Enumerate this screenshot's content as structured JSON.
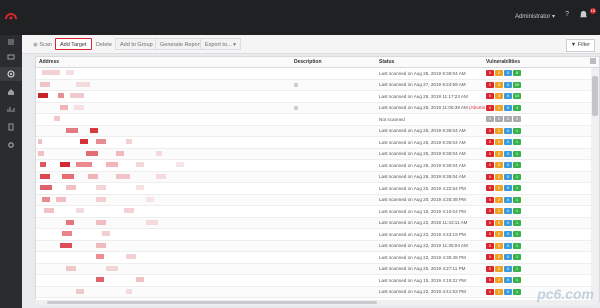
{
  "header": {
    "user_menu": "Administrator ▾",
    "help": "?",
    "notification_count": "18"
  },
  "toolbar": {
    "scan": "Scan",
    "add_target": "Add Target",
    "delete": "Delete",
    "add_to_group": "Add to Group",
    "generate_report": "Generate Report",
    "export": "Export to... ▾",
    "filter": "Filter"
  },
  "table": {
    "columns": [
      "Address",
      "Description",
      "Status",
      "Vulnerabilities"
    ],
    "rows": [
      {
        "status": "Last scanned on Aug 26, 2019 9:36:04 AM",
        "warn": "",
        "vulns": [
          "0",
          "2",
          "0",
          "8"
        ]
      },
      {
        "status": "Last scanned on Aug 27, 2019 9:24:59 AM",
        "warn": "",
        "vulns": [
          "0",
          "3",
          "0",
          "20"
        ]
      },
      {
        "status": "Last scanned on Aug 26, 2019 11:17:23 AM",
        "warn": "",
        "vulns": [
          "0",
          "3",
          "0",
          "10"
        ]
      },
      {
        "status": "Last scanned on Aug 26, 2019 11:06:39 AM",
        "warn": "(Abortin",
        "vulns": [
          "0",
          "1",
          "0",
          "4"
        ]
      },
      {
        "status": "Not scanned",
        "warn": "",
        "vulns": [
          "0",
          "0",
          "0",
          "0"
        ]
      },
      {
        "status": "Last scanned on Aug 26, 2019 9:36:04 AM",
        "warn": "",
        "vulns": [
          "0",
          "2",
          "0",
          "1"
        ]
      },
      {
        "status": "Last scanned on Aug 26, 2019 9:36:04 AM",
        "warn": "",
        "vulns": [
          "0",
          "2",
          "0",
          "1"
        ]
      },
      {
        "status": "Last scanned on Aug 26, 2019 9:36:04 AM",
        "warn": "",
        "vulns": [
          "0",
          "2",
          "0",
          "1"
        ]
      },
      {
        "status": "Last scanned on Aug 26, 2019 9:36:04 AM",
        "warn": "",
        "vulns": [
          "0",
          "2",
          "0",
          "1"
        ]
      },
      {
        "status": "Last scanned on Aug 26, 2019 9:36:04 AM",
        "warn": "",
        "vulns": [
          "0",
          "2",
          "0",
          "1"
        ]
      },
      {
        "status": "Last scanned on Aug 20, 2019 4:22:54 PM",
        "warn": "",
        "vulns": [
          "0",
          "2",
          "0",
          "1"
        ]
      },
      {
        "status": "Last scanned on Aug 20, 2019 4:25:48 PM",
        "warn": "",
        "vulns": [
          "0",
          "2",
          "0",
          "1"
        ]
      },
      {
        "status": "Last scanned on Aug 15, 2019 4:15:04 PM",
        "warn": "",
        "vulns": [
          "0",
          "2",
          "0",
          "1"
        ]
      },
      {
        "status": "Last scanned on Aug 22, 2019 11:43:11 AM",
        "warn": "",
        "vulns": [
          "0",
          "2",
          "0",
          "1"
        ]
      },
      {
        "status": "Last scanned on Aug 22, 2019 4:43:19 PM",
        "warn": "",
        "vulns": [
          "0",
          "2",
          "0",
          "1"
        ]
      },
      {
        "status": "Last scanned on Aug 22, 2019 11:35:04 AM",
        "warn": "",
        "vulns": [
          "0",
          "2",
          "0",
          "1"
        ]
      },
      {
        "status": "Last scanned on Aug 22, 2019 4:30:48 PM",
        "warn": "",
        "vulns": [
          "0",
          "2",
          "0",
          "1"
        ]
      },
      {
        "status": "Last scanned on Aug 20, 2019 4:27:11 PM",
        "warn": "",
        "vulns": [
          "0",
          "2",
          "0",
          "1"
        ]
      },
      {
        "status": "Last scanned on Aug 15, 2019 4:15:22 PM",
        "warn": "",
        "vulns": [
          "0",
          "2",
          "0",
          "1"
        ]
      },
      {
        "status": "Last scanned on Aug 22, 2019 4:41:53 PM",
        "warn": "",
        "vulns": [
          "0",
          "2",
          "0",
          "1"
        ]
      },
      {
        "status": "Last scanned on Aug 22, 2019 11:38:07 AM",
        "warn": "",
        "vulns": [
          "0",
          "2",
          "0",
          "1"
        ]
      }
    ]
  },
  "colors": {
    "critical": "#d9262f",
    "high": "#f0a020",
    "medium": "#3a9bd8",
    "low": "#36b24a",
    "none": "#a8aaae",
    "accent": "#d7262f"
  },
  "watermark": "pc6.com"
}
